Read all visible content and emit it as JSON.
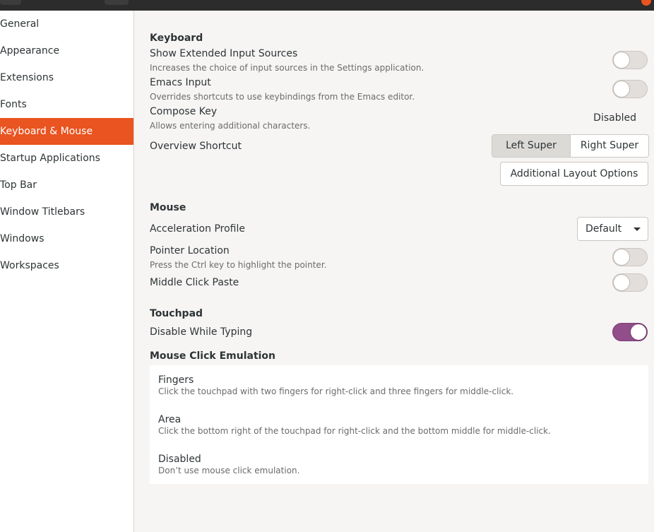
{
  "sidebar": {
    "items": [
      {
        "label": "General"
      },
      {
        "label": "Appearance"
      },
      {
        "label": "Extensions"
      },
      {
        "label": "Fonts"
      },
      {
        "label": "Keyboard & Mouse"
      },
      {
        "label": "Startup Applications"
      },
      {
        "label": "Top Bar"
      },
      {
        "label": "Window Titlebars"
      },
      {
        "label": "Windows"
      },
      {
        "label": "Workspaces"
      }
    ],
    "active_label": "Keyboard & Mouse"
  },
  "keyboard": {
    "section_title": "Keyboard",
    "extended_sources": {
      "title": "Show Extended Input Sources",
      "subtitle": "Increases the choice of input sources in the Settings application.",
      "on": false
    },
    "emacs": {
      "title": "Emacs Input",
      "subtitle": "Overrides shortcuts to use keybindings from the Emacs editor.",
      "on": false
    },
    "compose": {
      "title": "Compose Key",
      "subtitle": "Allows entering additional characters.",
      "value": "Disabled"
    },
    "overview": {
      "title": "Overview Shortcut",
      "left_label": "Left Super",
      "right_label": "Right Super",
      "selected": "Left Super"
    },
    "additional_layout_label": "Additional Layout Options"
  },
  "mouse": {
    "section_title": "Mouse",
    "accel": {
      "title": "Acceleration Profile",
      "value": "Default"
    },
    "pointer_location": {
      "title": "Pointer Location",
      "subtitle": "Press the Ctrl key to highlight the pointer.",
      "on": false
    },
    "middle_click": {
      "title": "Middle Click Paste",
      "on": false
    }
  },
  "touchpad": {
    "section_title": "Touchpad",
    "disable_typing": {
      "title": "Disable While Typing",
      "on": true
    }
  },
  "click_emulation": {
    "section_title": "Mouse Click Emulation",
    "options": [
      {
        "title": "Fingers",
        "subtitle": "Click the touchpad with two fingers for right-click and three fingers for middle-click."
      },
      {
        "title": "Area",
        "subtitle": "Click the bottom right of the touchpad for right-click and the bottom middle for middle-click."
      },
      {
        "title": "Disabled",
        "subtitle": "Don’t use mouse click emulation."
      }
    ]
  },
  "colors": {
    "accent": "#e95420",
    "switch_on": "#924d8b"
  }
}
